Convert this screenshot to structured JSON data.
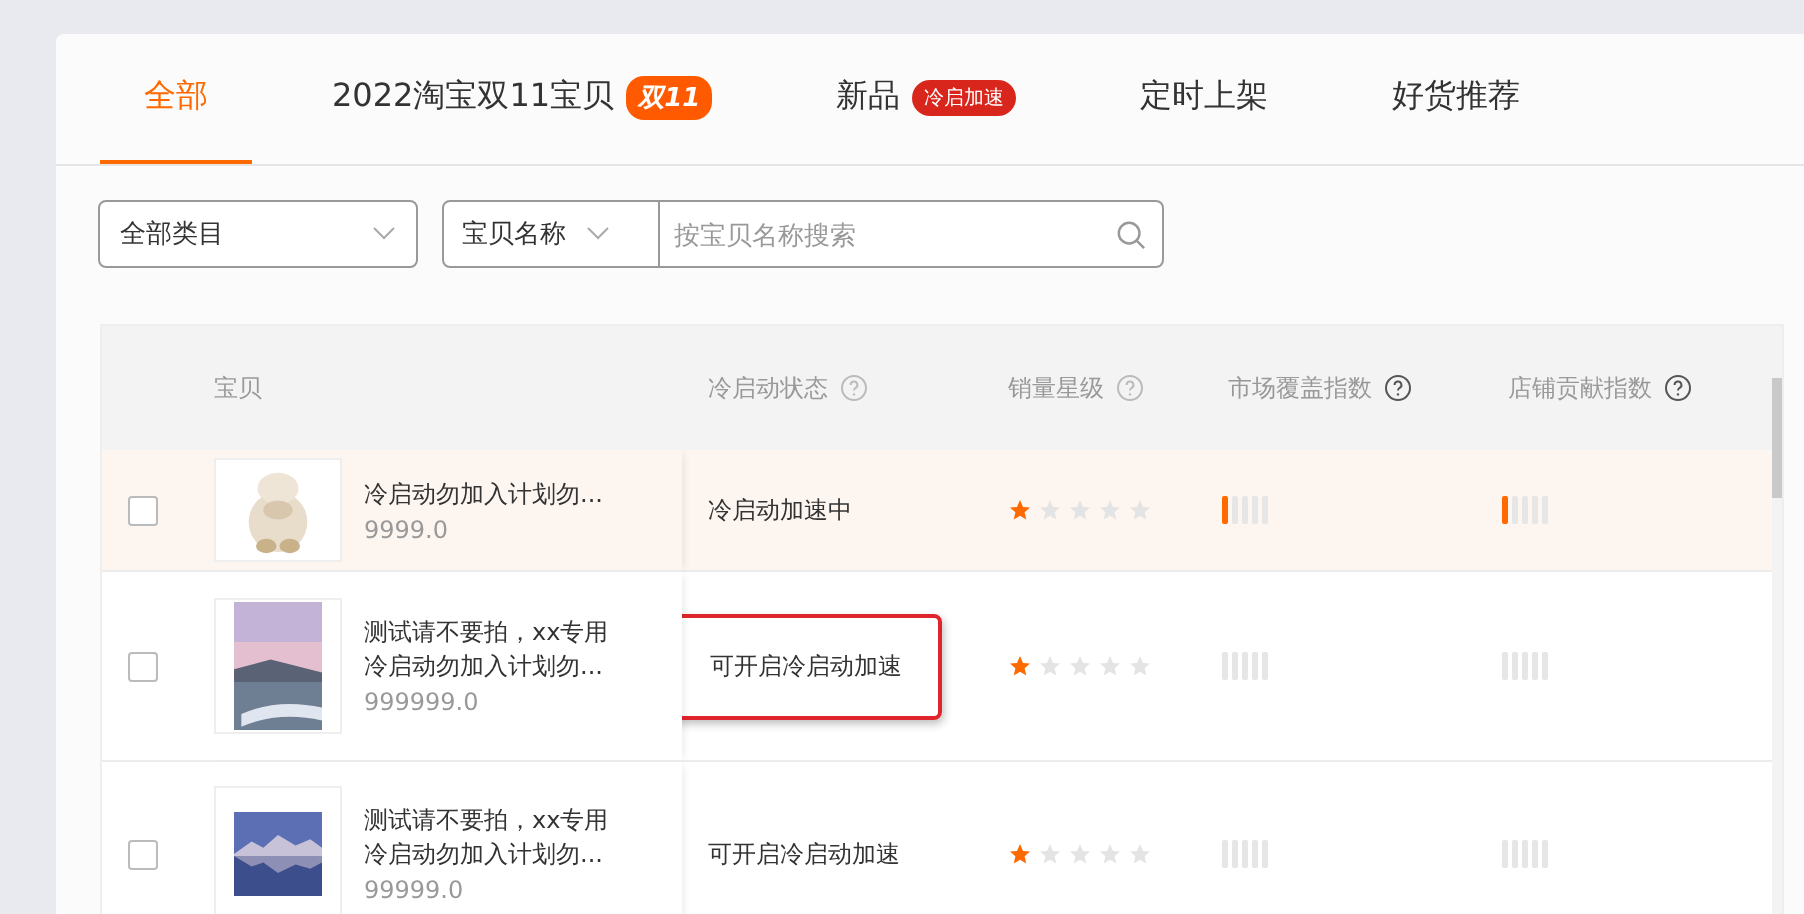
{
  "tabs": [
    {
      "label": "全部",
      "selected": true
    },
    {
      "label": "2022淘宝双11宝贝",
      "badge": {
        "text": "双11",
        "kind": "festival"
      },
      "selected": false
    },
    {
      "label": "新品",
      "badge": {
        "text": "冷启加速",
        "kind": "promo"
      },
      "selected": false
    },
    {
      "label": "定时上架",
      "selected": false
    },
    {
      "label": "好货推荐",
      "selected": false
    }
  ],
  "filters": {
    "category": "全部类目",
    "search_type": "宝贝名称",
    "search": {
      "placeholder": "按宝贝名称搜索"
    }
  },
  "table": {
    "columns": [
      {
        "label": "宝贝",
        "help": false
      },
      {
        "label": "冷启动状态",
        "help": true
      },
      {
        "label": "销量星级",
        "help": true
      },
      {
        "label": "市场覆盖指数",
        "help": true
      },
      {
        "label": "店铺贡献指数",
        "help": true
      }
    ],
    "rows": [
      {
        "checked": false,
        "highlighted": true,
        "title": "冷启动勿加入计划勿...",
        "price": "9999.0",
        "status": "冷启动加速中",
        "status_framed": false,
        "stars": 1,
        "market_active": true,
        "shop_active": true
      },
      {
        "checked": false,
        "highlighted": false,
        "title": "测试请不要拍，xx专用冷启动勿加入计划勿...",
        "price": "999999.0",
        "status": "可开启冷启动加速",
        "status_framed": true,
        "stars": 1,
        "market_active": false,
        "shop_active": false
      },
      {
        "checked": false,
        "highlighted": false,
        "title": "测试请不要拍，xx专用冷启动勿加入计划勿...",
        "price": "99999.0",
        "status": "可开启冷启动加速",
        "status_framed": false,
        "stars": 1,
        "market_active": false,
        "shop_active": false
      }
    ]
  }
}
